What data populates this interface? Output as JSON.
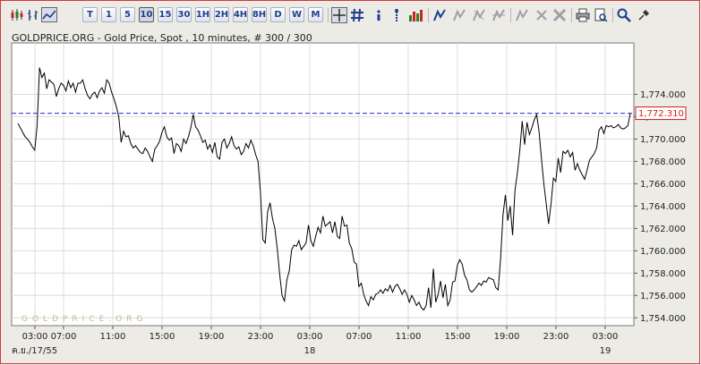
{
  "toolbar": {
    "timeframes": [
      "T",
      "1",
      "5",
      "10",
      "15",
      "30",
      "1H",
      "2H",
      "4H",
      "8H",
      "D",
      "W",
      "M"
    ],
    "active_timeframe": "10"
  },
  "chart_data": {
    "type": "line",
    "title": "GOLDPRICE.ORG - Gold Price, Spot , 10 minutes, # 300 / 300",
    "watermark": "GOLDPRICE.ORG",
    "last_price_label": "1,772.310",
    "last_price": 1772.31,
    "ylim": [
      1753.3,
      1778.6
    ],
    "y_ticks": [
      {
        "value": 1774,
        "label": "1,774.000"
      },
      {
        "value": 1772,
        "label": "1,772.000"
      },
      {
        "value": 1770,
        "label": "1,770.000"
      },
      {
        "value": 1768,
        "label": "1,768.000"
      },
      {
        "value": 1766,
        "label": "1,766.000"
      },
      {
        "value": 1764,
        "label": "1,764.000"
      },
      {
        "value": 1762,
        "label": "1,762.000"
      },
      {
        "value": 1760,
        "label": "1,760.000"
      },
      {
        "value": 1758,
        "label": "1,758.000"
      },
      {
        "value": 1756,
        "label": "1,756.000"
      },
      {
        "value": 1754,
        "label": "1,754.000"
      }
    ],
    "x_tick_labels": [
      "03:00",
      "07:00",
      "11:00",
      "15:00",
      "19:00",
      "23:00",
      "03:00",
      "07:00",
      "11:00",
      "15:00",
      "19:00",
      "23:00",
      "03:00"
    ],
    "date_labels": [
      "ค.ย./17/55",
      "18",
      "19"
    ],
    "grid": true,
    "series": [
      {
        "color": "#000000",
        "values": [
          1771.4,
          1771.0,
          1770.6,
          1770.2,
          1770.0,
          1769.7,
          1769.3,
          1769.0,
          1771.2,
          1776.4,
          1775.5,
          1775.9,
          1774.5,
          1775.3,
          1775.1,
          1774.9,
          1773.8,
          1774.5,
          1775.0,
          1774.8,
          1774.3,
          1775.2,
          1774.6,
          1775.0,
          1774.2,
          1775.0,
          1775.0,
          1775.3,
          1774.5,
          1773.9,
          1773.6,
          1774.0,
          1774.2,
          1773.7,
          1774.3,
          1774.6,
          1774.1,
          1775.3,
          1775.0,
          1774.2,
          1773.6,
          1772.9,
          1772.0,
          1769.7,
          1770.7,
          1770.2,
          1770.3,
          1769.6,
          1769.2,
          1769.4,
          1769.1,
          1768.8,
          1768.7,
          1769.2,
          1768.9,
          1768.4,
          1768.0,
          1769.1,
          1769.4,
          1769.8,
          1770.6,
          1771.1,
          1770.2,
          1769.9,
          1770.1,
          1768.7,
          1769.6,
          1769.4,
          1768.9,
          1770.0,
          1769.6,
          1770.2,
          1771.0,
          1772.2,
          1771.1,
          1770.8,
          1770.3,
          1769.7,
          1769.9,
          1769.1,
          1769.5,
          1768.8,
          1769.7,
          1768.4,
          1768.2,
          1769.7,
          1770.0,
          1769.2,
          1769.6,
          1770.2,
          1769.4,
          1769.1,
          1769.3,
          1768.6,
          1768.9,
          1769.6,
          1769.2,
          1769.9,
          1769.4,
          1768.6,
          1768.0,
          1765.2,
          1761.0,
          1760.7,
          1763.5,
          1764.3,
          1762.9,
          1762.0,
          1760.2,
          1757.9,
          1756.0,
          1755.5,
          1757.4,
          1758.2,
          1760.1,
          1760.5,
          1760.4,
          1760.9,
          1760.1,
          1760.4,
          1760.7,
          1762.3,
          1760.9,
          1760.4,
          1761.3,
          1762.1,
          1761.6,
          1763.1,
          1762.2,
          1762.4,
          1762.6,
          1761.6,
          1762.6,
          1761.3,
          1761.1,
          1763.1,
          1762.2,
          1762.3,
          1760.7,
          1760.2,
          1759.0,
          1758.8,
          1756.8,
          1757.1,
          1756.1,
          1755.5,
          1755.1,
          1755.9,
          1755.6,
          1756.1,
          1756.2,
          1756.5,
          1756.2,
          1756.6,
          1756.4,
          1756.9,
          1756.3,
          1756.8,
          1757.0,
          1756.6,
          1756.1,
          1756.5,
          1756.1,
          1755.4,
          1756.0,
          1755.6,
          1755.1,
          1755.4,
          1754.9,
          1754.7,
          1755.1,
          1756.7,
          1754.9,
          1758.4,
          1755.4,
          1756.1,
          1757.3,
          1755.8,
          1757.0,
          1755.1,
          1755.6,
          1757.2,
          1757.3,
          1758.7,
          1759.2,
          1758.8,
          1757.8,
          1757.4,
          1756.5,
          1756.3,
          1756.5,
          1756.8,
          1757.1,
          1756.9,
          1757.3,
          1757.2,
          1757.6,
          1757.5,
          1757.4,
          1756.7,
          1756.5,
          1759.3,
          1763.2,
          1765.0,
          1762.7,
          1764.0,
          1761.4,
          1765.4,
          1767.0,
          1769.0,
          1771.6,
          1769.5,
          1771.5,
          1770.4,
          1771.0,
          1771.7,
          1772.2,
          1770.7,
          1768.3,
          1766.0,
          1764.2,
          1762.4,
          1764.2,
          1766.5,
          1766.2,
          1768.3,
          1767.0,
          1768.9,
          1768.7,
          1769.0,
          1768.4,
          1768.8,
          1767.2,
          1767.8,
          1767.2,
          1766.8,
          1766.4,
          1767.2,
          1768.1,
          1768.4,
          1768.7,
          1769.2,
          1770.8,
          1771.1,
          1770.5,
          1771.2,
          1771.1,
          1771.2,
          1771.0,
          1771.1,
          1771.3,
          1771.0,
          1770.9,
          1771.0,
          1771.2,
          1772.3
        ]
      }
    ]
  }
}
